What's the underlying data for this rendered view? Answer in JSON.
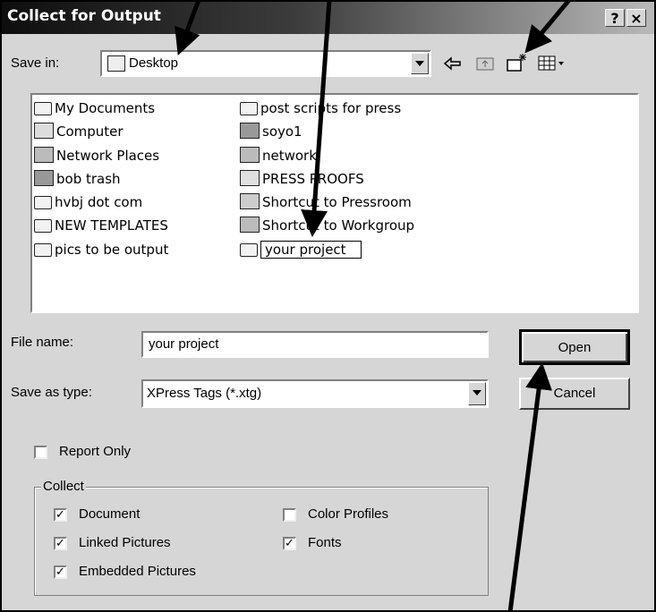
{
  "window": {
    "title": "Collect for Output",
    "help_glyph": "?",
    "close_glyph": "×"
  },
  "toolbar": {
    "save_in_label": "Save in:",
    "save_in_value": "Desktop",
    "icons": [
      "back-arrow-icon",
      "up-folder-icon",
      "new-folder-icon",
      "view-menu-icon"
    ]
  },
  "files": {
    "column1": [
      {
        "name": "My Documents",
        "icon": "my-documents-icon"
      },
      {
        "name": "Computer",
        "icon": "computer-icon"
      },
      {
        "name": "Network Places",
        "icon": "network-places-icon"
      },
      {
        "name": "bob trash",
        "icon": "network-drive-icon"
      },
      {
        "name": "hvbj dot com",
        "icon": "folder-icon"
      },
      {
        "name": "NEW TEMPLATES",
        "icon": "folder-icon"
      },
      {
        "name": "pics to be output",
        "icon": "folder-icon"
      }
    ],
    "column2": [
      {
        "name": "post scripts for press",
        "icon": "folder-icon"
      },
      {
        "name": "soyo1",
        "icon": "network-drive-icon"
      },
      {
        "name": "network",
        "icon": "network-icon"
      },
      {
        "name": "PRESS PROOFS",
        "icon": "shared-folder-icon"
      },
      {
        "name": "Shortcut to Pressroom",
        "icon": "computer-shortcut-icon"
      },
      {
        "name": "Shortcut to Workgroup",
        "icon": "network-shortcut-icon"
      },
      {
        "name": "your project",
        "icon": "folder-icon",
        "editing": true
      }
    ]
  },
  "form": {
    "file_name_label": "File name:",
    "file_name_value": "your project",
    "save_as_type_label": "Save as type:",
    "save_as_type_value": "XPress Tags (*.xtg)"
  },
  "buttons": {
    "open": "Open",
    "cancel": "Cancel"
  },
  "report_only": {
    "label": "Report Only",
    "checked": false
  },
  "collect": {
    "legend": "Collect",
    "options": [
      {
        "label": "Document",
        "checked": true
      },
      {
        "label": "Linked Pictures",
        "checked": true
      },
      {
        "label": "Embedded Pictures",
        "checked": true
      },
      {
        "label": "Color Profiles",
        "checked": false
      },
      {
        "label": "Fonts",
        "checked": true
      }
    ]
  }
}
